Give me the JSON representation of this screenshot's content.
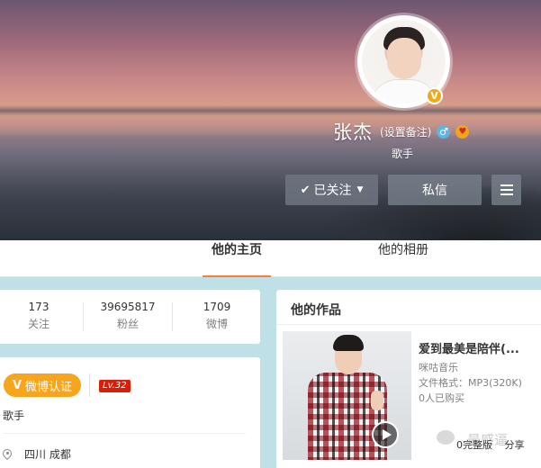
{
  "profile": {
    "name": "张杰",
    "remark_label": "(设置备注)",
    "gender_icon": "male-icon",
    "verified_badge": "V",
    "description": "歌手"
  },
  "actions": {
    "follow_label": "已关注",
    "message_label": "私信"
  },
  "tabs": [
    {
      "label": "他的主页",
      "active": true
    },
    {
      "label": "他的相册",
      "active": false
    }
  ],
  "stats": [
    {
      "value": "173",
      "label": "关注"
    },
    {
      "value": "39695817",
      "label": "粉丝"
    },
    {
      "value": "1709",
      "label": "微博"
    }
  ],
  "info": {
    "verify_label": "微博认证",
    "level": "Lv.32",
    "description": "歌手",
    "location": "四川 成都"
  },
  "works": {
    "title": "他的作品",
    "item": {
      "title": "爱到最美是陪伴(...",
      "source": "咪咕音乐",
      "format": "文件格式：MP3(320K)",
      "buyers": "0人已购买",
      "footer": "0完整版",
      "share": "分享"
    },
    "watermark": "最感逼"
  },
  "colors": {
    "accent": "#fa7d3c",
    "verify": "#f7a51d",
    "level": "#d81e06"
  }
}
